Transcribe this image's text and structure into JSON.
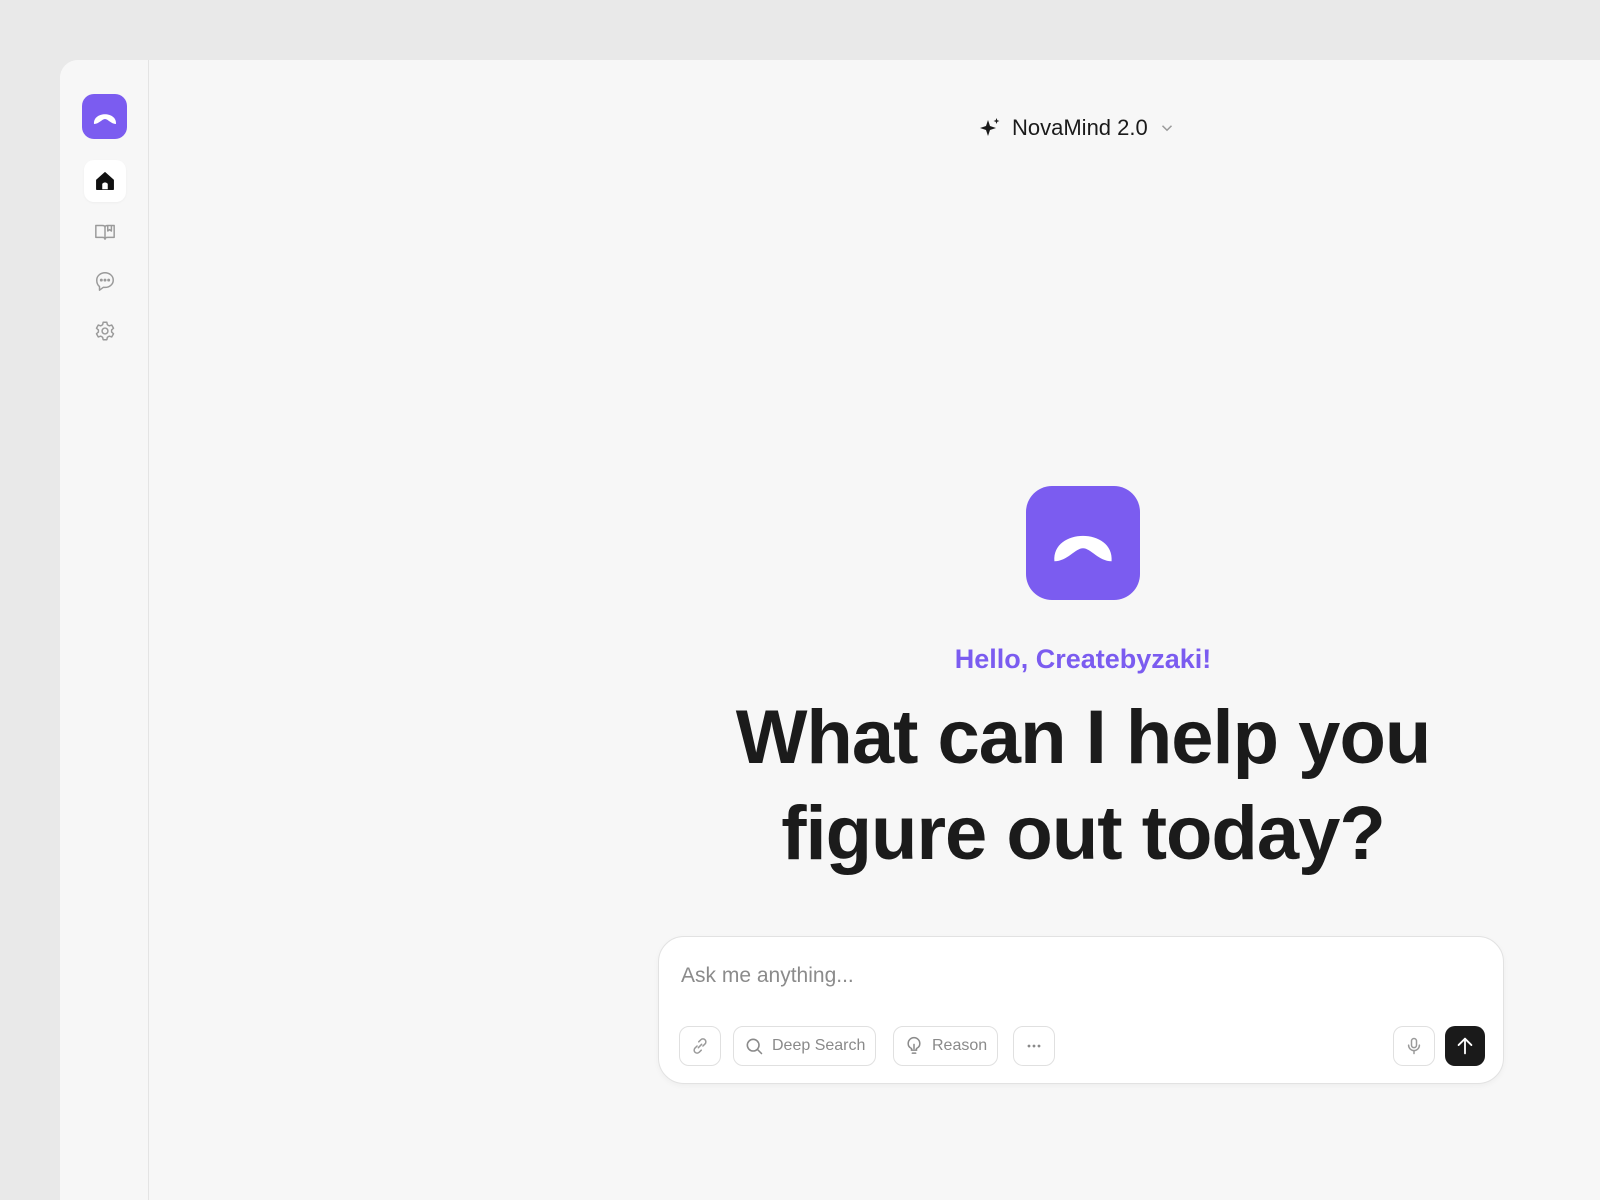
{
  "model_selector": {
    "name": "NovaMind 2.0",
    "icon": "sparkle-icon"
  },
  "sidebar": {
    "items": [
      {
        "name": "home",
        "icon": "home-icon",
        "active": true
      },
      {
        "name": "library",
        "icon": "book-icon",
        "active": false
      },
      {
        "name": "chats",
        "icon": "chat-bubble-icon",
        "active": false
      },
      {
        "name": "settings",
        "icon": "gear-icon",
        "active": false
      }
    ]
  },
  "hero": {
    "greeting": "Hello, Createbyzaki!",
    "headline": "What can I help you figure out today?"
  },
  "composer": {
    "placeholder": "Ask me anything...",
    "tools": {
      "deep_search": "Deep Search",
      "reason": "Reason"
    }
  },
  "colors": {
    "accent": "#7b5cf0",
    "text": "#1b1b1b",
    "background": "#f7f7f7"
  }
}
